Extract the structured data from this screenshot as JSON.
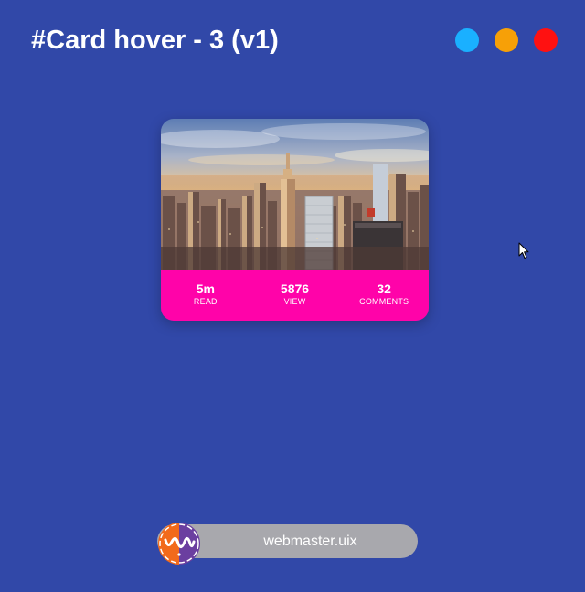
{
  "page": {
    "title": "#Card hover - 3 (v1)",
    "background_color": "#3148a8"
  },
  "color_dots": [
    {
      "name": "blue-dot",
      "color": "#1ab0ff"
    },
    {
      "name": "orange-dot",
      "color": "#f7a007"
    },
    {
      "name": "red-dot",
      "color": "#ff1111"
    }
  ],
  "card": {
    "image_icon": "city-skyline-photo",
    "stats_background": "#ff03a9",
    "stats": [
      {
        "value": "5m",
        "label": "READ"
      },
      {
        "value": "5876",
        "label": "VIEW"
      },
      {
        "value": "32",
        "label": "COMMENTS"
      }
    ]
  },
  "footer": {
    "label": "webmaster.uix",
    "logo_icon": "webmaster-logo"
  }
}
